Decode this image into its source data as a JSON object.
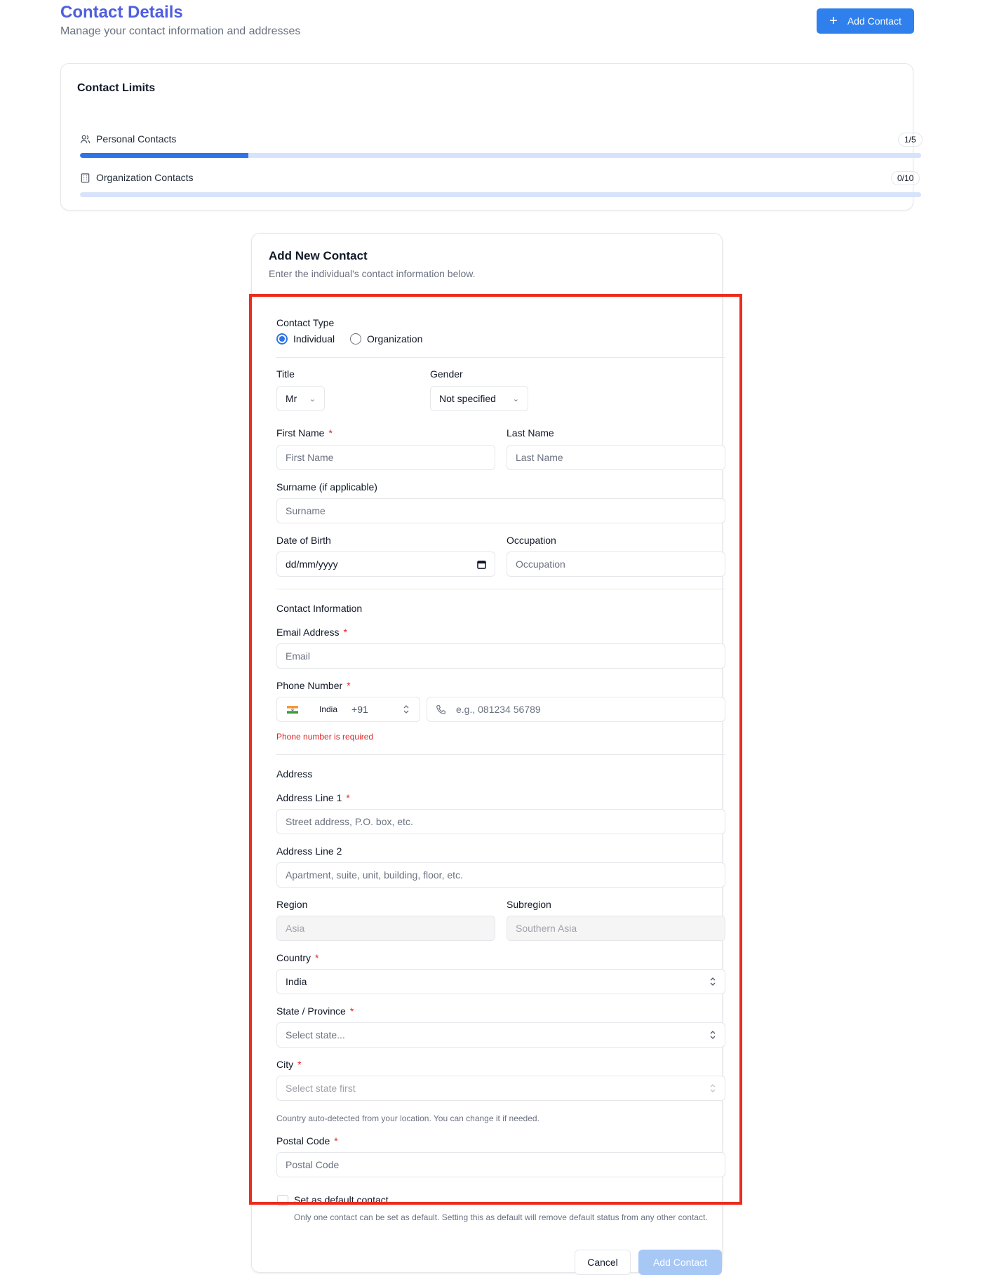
{
  "header": {
    "title": "Contact Details",
    "subtitle": "Manage your contact information and addresses",
    "add_button_label": "Add Contact"
  },
  "limits": {
    "title": "Contact Limits",
    "personal": {
      "label": "Personal Contacts",
      "badge": "1/5",
      "used": 1,
      "max": 5
    },
    "organization": {
      "label": "Organization Contacts",
      "badge": "0/10",
      "used": 0,
      "max": 10
    }
  },
  "form": {
    "title": "Add New Contact",
    "description": "Enter the individual's contact information below.",
    "contact_type": {
      "label": "Contact Type",
      "options": [
        "Individual",
        "Organization"
      ],
      "selected": "Individual"
    },
    "title_field": {
      "label": "Title",
      "value": "Mr"
    },
    "gender_field": {
      "label": "Gender",
      "value": "Not specified"
    },
    "first_name": {
      "label": "First Name",
      "placeholder": "First Name"
    },
    "last_name": {
      "label": "Last Name",
      "placeholder": "Last Name"
    },
    "surname": {
      "label": "Surname (if applicable)",
      "placeholder": "Surname"
    },
    "dob": {
      "label": "Date of Birth",
      "placeholder": "dd/mm/yyyy"
    },
    "occupation": {
      "label": "Occupation",
      "placeholder": "Occupation"
    },
    "contact_info_heading": "Contact Information",
    "email": {
      "label": "Email Address",
      "placeholder": "Email"
    },
    "phone": {
      "label": "Phone Number",
      "country": "India",
      "dial_code": "+91",
      "placeholder": "e.g., 081234 56789",
      "error": "Phone number is required"
    },
    "address_heading": "Address",
    "address1": {
      "label": "Address Line 1",
      "placeholder": "Street address, P.O. box, etc."
    },
    "address2": {
      "label": "Address Line 2",
      "placeholder": "Apartment, suite, unit, building, floor, etc."
    },
    "region": {
      "label": "Region",
      "placeholder": "Asia"
    },
    "subregion": {
      "label": "Subregion",
      "placeholder": "Southern Asia"
    },
    "country": {
      "label": "Country",
      "value": "India"
    },
    "state": {
      "label": "State / Province",
      "placeholder": "Select state..."
    },
    "city": {
      "label": "City",
      "placeholder": "Select state first"
    },
    "country_hint": "Country auto-detected from your location. You can change it if needed.",
    "postal_code": {
      "label": "Postal Code",
      "placeholder": "Postal Code"
    },
    "default_contact": {
      "label": "Set as default contact",
      "help": "Only one contact can be set as default. Setting this as default will remove default status from any other contact."
    },
    "required_marker": "*",
    "cancel_label": "Cancel",
    "submit_label": "Add Contact"
  },
  "colors": {
    "brand_title": "#4f5fe0",
    "primary": "#2f80ed",
    "progress_fill": "#2f74e6",
    "progress_track": "#d7e3fb",
    "error": "#dc2626",
    "highlight": "#ea2d1f",
    "submit_disabled": "#a7c8f5"
  }
}
